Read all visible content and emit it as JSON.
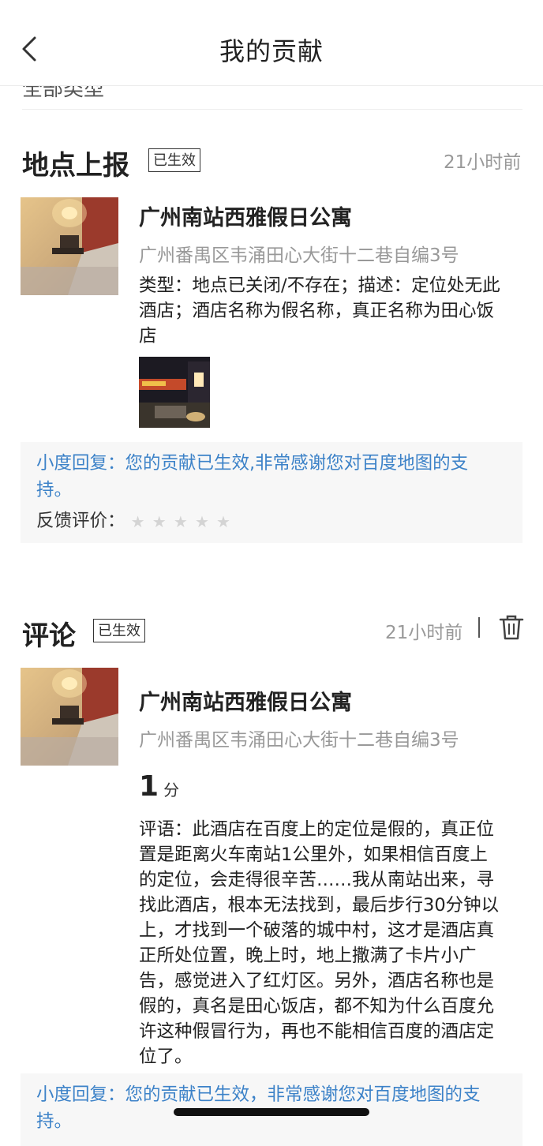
{
  "nav": {
    "title": "我的贡献"
  },
  "filter": {
    "label": "全部类型"
  },
  "report": {
    "title": "地点上报",
    "badge": "已生效",
    "time": "21小时前",
    "place_name": "广州南站西雅假日公寓",
    "address": "广州番禺区韦涌田心大街十二巷自编3号",
    "desc_lines": [
      "类型：地点已关闭/不存在；描述：定位处无此",
      "酒店；酒店名称为假名称，真正名称为田心饭",
      "店"
    ],
    "reply_lines": [
      "小度回复：您的贡献已生效,非常感谢您对百度地图的支",
      "持。"
    ],
    "rating_label": "反馈评价：",
    "stars": 5
  },
  "comment": {
    "title": "评论",
    "badge": "已生效",
    "time": "21小时前",
    "place_name": "广州南站西雅假日公寓",
    "address": "广州番禺区韦涌田心大街十二巷自编3号",
    "score": "1",
    "score_unit": "分",
    "review_lines": [
      "评语：此酒店在百度上的定位是假的，真正位",
      "置是距离火车南站1公里外，如果相信百度上",
      "的定位，会走得很辛苦……我从南站出来，寻",
      "找此酒店，根本无法找到，最后步行30分钟以",
      "上，才找到一个破落的城中村，这才是酒店真",
      "正所处位置，晚上时，地上撒满了卡片小广",
      "告，感觉进入了红灯区。另外，酒店名称也是",
      "假的，真名是田心饭店，都不知为什么百度允",
      "许这种假冒行为，再也不能相信百度的酒店定",
      "位了。"
    ],
    "reply_lines": [
      "小度回复：您的贡献已生效，非常感谢您对百度地图的支",
      "持。"
    ]
  },
  "icons": {
    "back": "chevron-left-icon",
    "trash": "trash-icon",
    "star": "star-icon"
  },
  "colors": {
    "reply": "#3c82c8",
    "muted": "#999999",
    "reply_bg": "#f7f7f7"
  }
}
